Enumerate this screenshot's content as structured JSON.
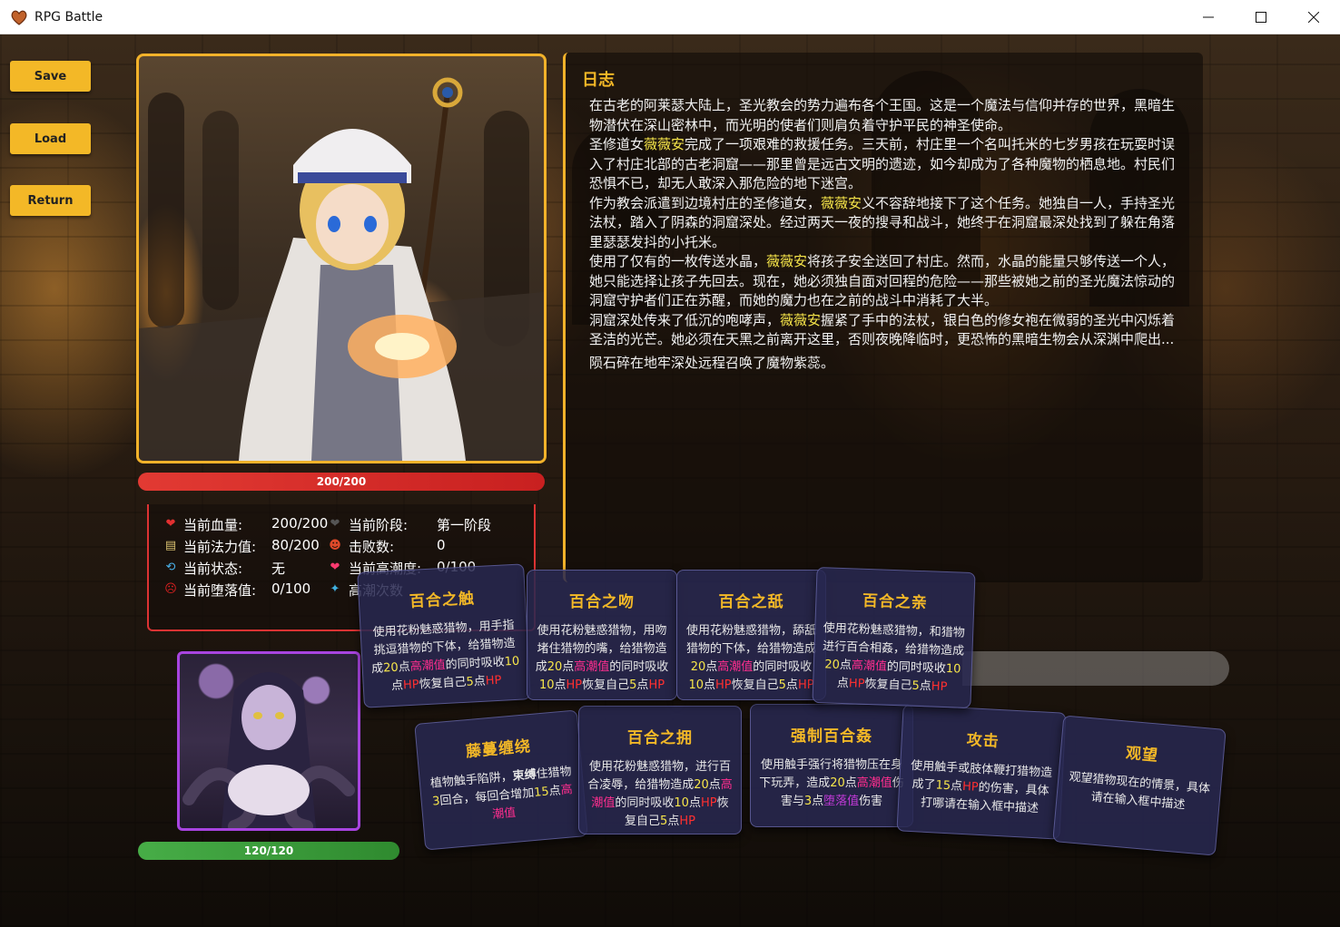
{
  "window": {
    "title": "RPG Battle"
  },
  "buttons": {
    "save": "Save",
    "load": "Load",
    "return": "Return"
  },
  "player": {
    "hp_text": "200/200",
    "hp_fraction": 1.0
  },
  "enemy": {
    "hp_text": "120/120",
    "hp_fraction": 1.0
  },
  "stats": {
    "hp_label": "当前血量:",
    "hp_value": "200/200",
    "stage_label": "当前阶段:",
    "stage_value": "第一阶段",
    "mp_label": "当前法力值:",
    "mp_value": "80/200",
    "defeat_label": "击败数:",
    "defeat_value": "0",
    "status_label": "当前状态:",
    "status_value": "无",
    "climax_label": "当前高潮度:",
    "climax_value": "0/100",
    "corrupt_label": "当前堕落值:",
    "corrupt_value": "0/100",
    "climax_count_label": "高潮次数"
  },
  "log": {
    "title": "日志",
    "p1": "在古老的阿莱瑟大陆上，圣光教会的势力遍布各个王国。这是一个魔法与信仰并存的世界，黑暗生物潜伏在深山密林中，而光明的使者们则肩负着守护平民的神圣使命。",
    "p2a": "圣修道女",
    "p2name": "薇薇安",
    "p2b": "完成了一项艰难的救援任务。三天前，村庄里一个名叫托米的七岁男孩在玩耍时误入了村庄北部的古老洞窟——那里曾是远古文明的遗迹，如今却成为了各种魔物的栖息地。村民们恐惧不已，却无人敢深入那危险的地下迷宫。",
    "p3a": "作为教会派遣到边境村庄的圣修道女，",
    "p3name": "薇薇安",
    "p3b": "义不容辞地接下了这个任务。她独自一人，手持圣光法杖，踏入了阴森的洞窟深处。经过两天一夜的搜寻和战斗，她终于在洞窟最深处找到了躲在角落里瑟瑟发抖的小托米。",
    "p4a": "使用了仅有的一枚传送水晶，",
    "p4name": "薇薇安",
    "p4b": "将孩子安全送回了村庄。然而，水晶的能量只够传送一个人，她只能选择让孩子先回去。现在，她必须独自面对回程的危险——那些被她之前的圣光魔法惊动的洞窟守护者们正在苏醒，而她的魔力也在之前的战斗中消耗了大半。",
    "p5a": "洞窟深处传来了低沉的咆哮声，",
    "p5name": "薇薇安",
    "p5b": "握紧了手中的法杖，银白色的修女袍在微弱的圣光中闪烁着圣洁的光芒。她必须在天黑之前离开这里，否则夜晚降临时，更恐怖的黑暗生物会从深渊中爬出...",
    "p6": "陨石碎在地牢深处远程召唤了魔物紫蕊。"
  },
  "cards": [
    {
      "name": "百合之触",
      "t1": "使用花粉魅惑猎物，用手指挑逗猎物的下体，给猎物造成",
      "n1": "20",
      "t2": "点",
      "k1": "高潮值",
      "t3": "的同时吸收",
      "n2": "10",
      "t4": "点",
      "k2": "HP",
      "t5": "恢复自己",
      "n3": "5",
      "t6": "点",
      "k3": "HP"
    },
    {
      "name": "百合之吻",
      "t1": "使用花粉魅惑猎物，用吻堵住猎物的嘴，给猎物造成",
      "n1": "20",
      "t2": "点",
      "k1": "高潮值",
      "t3": "的同时吸收",
      "n2": "10",
      "t4": "点",
      "k2": "HP",
      "t5": "恢复自己",
      "n3": "5",
      "t6": "点",
      "k3": "HP"
    },
    {
      "name": "百合之舐",
      "t1": "使用花粉魅惑猎物，舔舐猎物的下体，给猎物造成",
      "n1": "20",
      "t2": "点",
      "k1": "高潮值",
      "t3": "的同时吸收",
      "n2": "10",
      "t4": "点",
      "k2": "HP",
      "t5": "恢复自己",
      "n3": "5",
      "t6": "点",
      "k3": "HP"
    },
    {
      "name": "百合之亲",
      "t1": "使用花粉魅惑猎物，和猎物进行百合相姦，给猎物造成",
      "n1": "20",
      "t2": "点",
      "k1": "高潮值",
      "t3": "的同时吸收",
      "n2": "10",
      "t4": "点",
      "k2": "HP",
      "t5": "恢复自己",
      "n3": "5",
      "t6": "点",
      "k3": "HP"
    },
    {
      "name": "藤蔓缠绕",
      "t1": "植物触手陷阱，",
      "b1": "束缚",
      "t2": "住猎物",
      "n1": "3",
      "t3": "回合，每回合增加",
      "n2": "15",
      "t4": "点",
      "k1": "高潮值"
    },
    {
      "name": "百合之拥",
      "t1": "使用花粉魅惑猎物，进行百合凌辱，给猎物造成",
      "n1": "20",
      "t2": "点",
      "k1": "高潮值",
      "t3": "的同时吸收",
      "n2": "10",
      "t4": "点",
      "k2": "HP",
      "t5": "恢复自己",
      "n3": "5",
      "t6": "点",
      "k3": "HP"
    },
    {
      "name": "强制百合姦",
      "t1": "使用触手强行将猎物压在身下玩弄，造成",
      "n1": "20",
      "t2": "点",
      "k1": "高潮值",
      "t3": "伤害与",
      "n2": "3",
      "t4": "点",
      "k2": "堕落值",
      "t5": "伤害"
    },
    {
      "name": "攻击",
      "t1": "使用触手或肢体鞭打猎物造成了",
      "n1": "15",
      "t2": "点",
      "k1": "HP",
      "t3": "的伤害，具体打哪请在输入框中描述"
    },
    {
      "name": "观望",
      "t1": "观望猎物现在的情景，具体请在输入框中描述"
    }
  ],
  "colors": {
    "accent": "#f3b827",
    "hp_player": "#e0332d",
    "hp_enemy": "#3b9a3b",
    "enemy_frame": "#a844e0"
  }
}
